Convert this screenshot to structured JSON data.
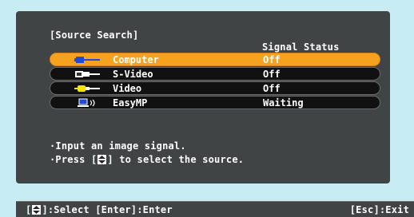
{
  "title": "[Source Search]",
  "columns": {
    "status_header": "Signal Status"
  },
  "sources": [
    {
      "label": "Computer",
      "status": "Off",
      "icon": "computer-cable-icon",
      "selected": true
    },
    {
      "label": "S-Video",
      "status": "Off",
      "icon": "svideo-plug-icon",
      "selected": false
    },
    {
      "label": "Video",
      "status": "Off",
      "icon": "video-plug-icon",
      "selected": false
    },
    {
      "label": "EasyMP",
      "status": "Waiting",
      "icon": "easymp-network-icon",
      "selected": false
    }
  ],
  "messages": {
    "line1": "·Input an image signal.",
    "line2_prefix": "·Press [",
    "line2_suffix": "] to select the source."
  },
  "statusbar": {
    "left_prefix": "[",
    "left_rest": "]:Select [Enter]:Enter",
    "right": "[Esc]:Exit"
  },
  "colors": {
    "background": "#c8ecf4",
    "panel": "#404444",
    "selected_row": "#f7a21e"
  }
}
